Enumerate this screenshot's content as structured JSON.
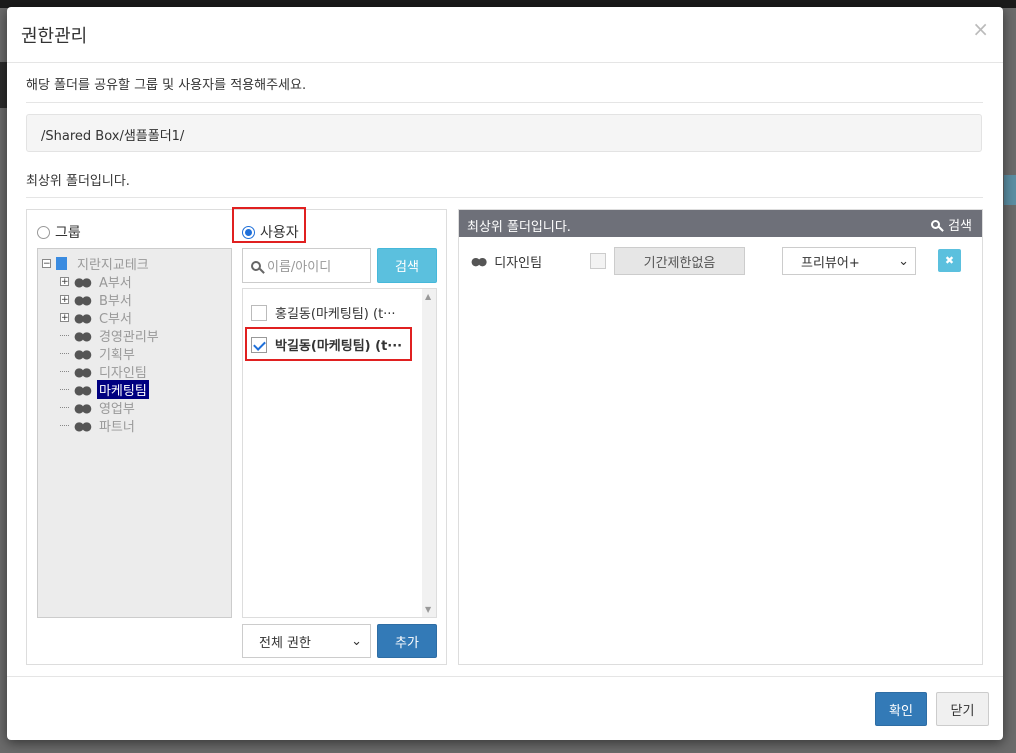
{
  "dialog": {
    "title": "권한관리",
    "close_symbol": "×",
    "description": "해당 폴더를 공유할 그룹 및 사용자를 적용해주세요.",
    "path": "/Shared Box/샘플폴더1/",
    "top_folder_note": "최상위 폴더입니다."
  },
  "selector": {
    "group_label": "그룹",
    "user_label": "사용자",
    "selected": "user"
  },
  "tree": {
    "root": "지란지교테크",
    "nodes": [
      {
        "label": "A부서",
        "expandable": true
      },
      {
        "label": "B부서",
        "expandable": true
      },
      {
        "label": "C부서",
        "expandable": true
      },
      {
        "label": "경영관리부",
        "expandable": false
      },
      {
        "label": "기획부",
        "expandable": false
      },
      {
        "label": "디자인팀",
        "expandable": false
      },
      {
        "label": "마케팅팀",
        "expandable": false,
        "selected": true
      },
      {
        "label": "영업부",
        "expandable": false
      },
      {
        "label": "파트너",
        "expandable": false
      }
    ]
  },
  "user_search": {
    "placeholder": "이름/아이디",
    "button": "검색"
  },
  "users": [
    {
      "label": "홍길동(마케팅팀) (t···",
      "checked": false
    },
    {
      "label": "박길동(마케팅팀) (t···",
      "checked": true
    }
  ],
  "permission_select": {
    "value": "전체 권한",
    "arrow": "⌄"
  },
  "add_button": "추가",
  "right_panel": {
    "header": "최상위 폴더입니다.",
    "search": "검색",
    "entries": [
      {
        "name": "디자인팀",
        "period": "기간제한없음",
        "role": "프리뷰어+",
        "checked": false
      }
    ]
  },
  "footer": {
    "ok": "확인",
    "close": "닫기"
  },
  "colors": {
    "primary": "#337ab7",
    "info": "#5bc0de",
    "highlight": "#e02020",
    "tree_selected": "#000080"
  }
}
